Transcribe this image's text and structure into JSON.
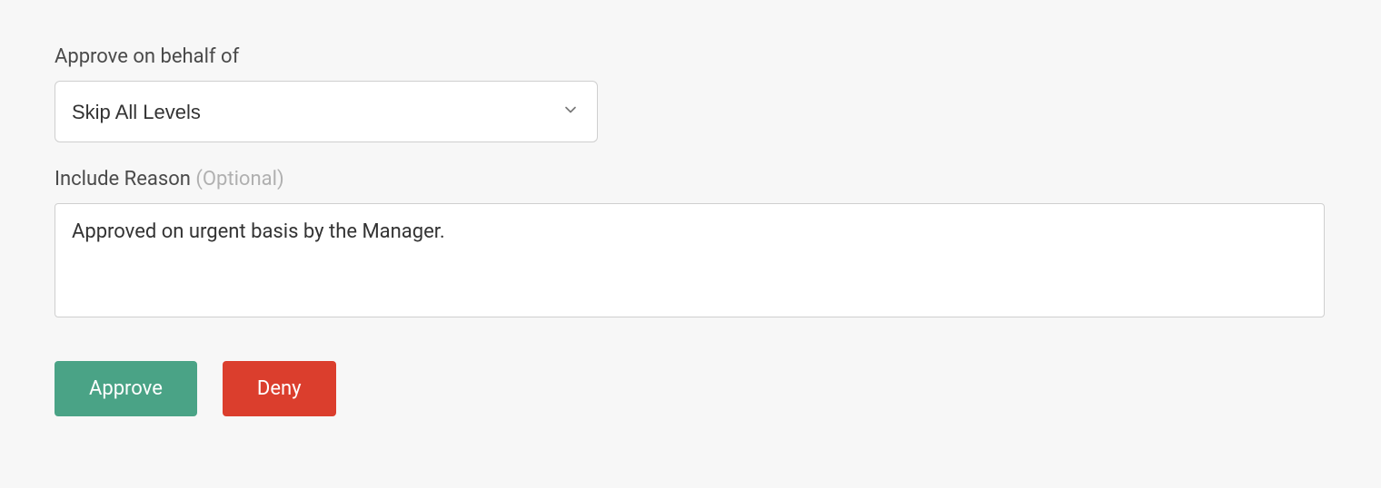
{
  "approve_behalf": {
    "label": "Approve on behalf of",
    "selected": "Skip All Levels"
  },
  "reason": {
    "label": "Include Reason ",
    "optional_hint": "(Optional)",
    "value": "Approved on urgent basis by the Manager."
  },
  "actions": {
    "approve_label": "Approve",
    "deny_label": "Deny"
  }
}
